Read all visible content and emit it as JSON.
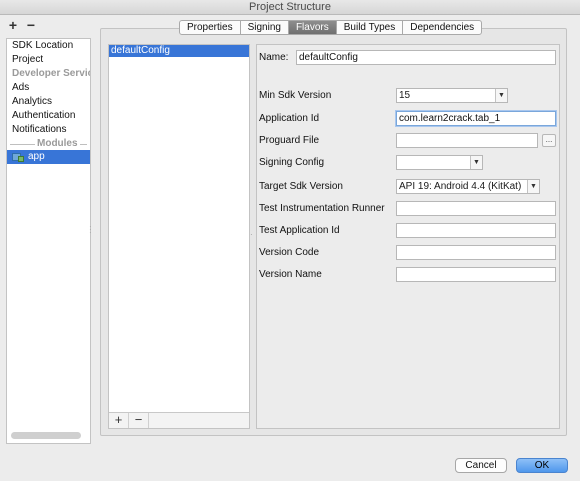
{
  "window": {
    "title": "Project Structure"
  },
  "left_toolbar": {
    "add_label": "+",
    "remove_label": "−"
  },
  "sidebar": {
    "items": [
      {
        "label": "SDK Location"
      },
      {
        "label": "Project"
      },
      {
        "label": "Developer Servic"
      },
      {
        "label": "Ads"
      },
      {
        "label": "Analytics"
      },
      {
        "label": "Authentication"
      },
      {
        "label": "Notifications"
      }
    ],
    "modules_header": "Modules",
    "selected_module": "app"
  },
  "tabs": [
    {
      "label": "Properties"
    },
    {
      "label": "Signing"
    },
    {
      "label": "Flavors"
    },
    {
      "label": "Build Types"
    },
    {
      "label": "Dependencies"
    }
  ],
  "active_tab": "Flavors",
  "flavors_list": {
    "selected": "defaultConfig",
    "add_label": "+",
    "remove_label": "−"
  },
  "form": {
    "name_label": "Name:",
    "name_value": "defaultConfig",
    "min_sdk_label": "Min Sdk Version",
    "min_sdk_value": "15",
    "app_id_label": "Application Id",
    "app_id_value": "com.learn2crack.tab_1",
    "proguard_label": "Proguard File",
    "proguard_value": "",
    "browse_label": "...",
    "signing_label": "Signing Config",
    "signing_value": "",
    "target_sdk_label": "Target Sdk Version",
    "target_sdk_value": "API 19: Android 4.4 (KitKat)",
    "test_runner_label": "Test Instrumentation Runner",
    "test_runner_value": "",
    "test_app_id_label": "Test Application Id",
    "test_app_id_value": "",
    "version_code_label": "Version Code",
    "version_code_value": "",
    "version_name_label": "Version Name",
    "version_name_value": ""
  },
  "footer": {
    "cancel_label": "Cancel",
    "ok_label": "OK"
  },
  "colors": {
    "selection": "#3875d7",
    "ok_button": "#5aa0ee",
    "active_tab": "#7a7a7a"
  }
}
